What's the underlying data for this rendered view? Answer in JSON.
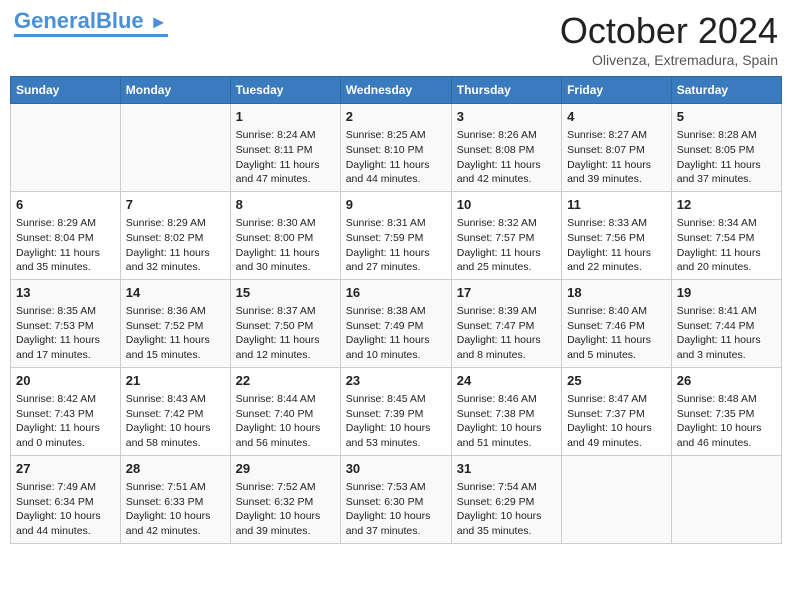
{
  "header": {
    "logo_line1": "General",
    "logo_line2": "Blue",
    "month": "October 2024",
    "location": "Olivenza, Extremadura, Spain"
  },
  "days_of_week": [
    "Sunday",
    "Monday",
    "Tuesday",
    "Wednesday",
    "Thursday",
    "Friday",
    "Saturday"
  ],
  "weeks": [
    [
      {
        "day": "",
        "content": ""
      },
      {
        "day": "",
        "content": ""
      },
      {
        "day": "1",
        "content": "Sunrise: 8:24 AM\nSunset: 8:11 PM\nDaylight: 11 hours and 47 minutes."
      },
      {
        "day": "2",
        "content": "Sunrise: 8:25 AM\nSunset: 8:10 PM\nDaylight: 11 hours and 44 minutes."
      },
      {
        "day": "3",
        "content": "Sunrise: 8:26 AM\nSunset: 8:08 PM\nDaylight: 11 hours and 42 minutes."
      },
      {
        "day": "4",
        "content": "Sunrise: 8:27 AM\nSunset: 8:07 PM\nDaylight: 11 hours and 39 minutes."
      },
      {
        "day": "5",
        "content": "Sunrise: 8:28 AM\nSunset: 8:05 PM\nDaylight: 11 hours and 37 minutes."
      }
    ],
    [
      {
        "day": "6",
        "content": "Sunrise: 8:29 AM\nSunset: 8:04 PM\nDaylight: 11 hours and 35 minutes."
      },
      {
        "day": "7",
        "content": "Sunrise: 8:29 AM\nSunset: 8:02 PM\nDaylight: 11 hours and 32 minutes."
      },
      {
        "day": "8",
        "content": "Sunrise: 8:30 AM\nSunset: 8:00 PM\nDaylight: 11 hours and 30 minutes."
      },
      {
        "day": "9",
        "content": "Sunrise: 8:31 AM\nSunset: 7:59 PM\nDaylight: 11 hours and 27 minutes."
      },
      {
        "day": "10",
        "content": "Sunrise: 8:32 AM\nSunset: 7:57 PM\nDaylight: 11 hours and 25 minutes."
      },
      {
        "day": "11",
        "content": "Sunrise: 8:33 AM\nSunset: 7:56 PM\nDaylight: 11 hours and 22 minutes."
      },
      {
        "day": "12",
        "content": "Sunrise: 8:34 AM\nSunset: 7:54 PM\nDaylight: 11 hours and 20 minutes."
      }
    ],
    [
      {
        "day": "13",
        "content": "Sunrise: 8:35 AM\nSunset: 7:53 PM\nDaylight: 11 hours and 17 minutes."
      },
      {
        "day": "14",
        "content": "Sunrise: 8:36 AM\nSunset: 7:52 PM\nDaylight: 11 hours and 15 minutes."
      },
      {
        "day": "15",
        "content": "Sunrise: 8:37 AM\nSunset: 7:50 PM\nDaylight: 11 hours and 12 minutes."
      },
      {
        "day": "16",
        "content": "Sunrise: 8:38 AM\nSunset: 7:49 PM\nDaylight: 11 hours and 10 minutes."
      },
      {
        "day": "17",
        "content": "Sunrise: 8:39 AM\nSunset: 7:47 PM\nDaylight: 11 hours and 8 minutes."
      },
      {
        "day": "18",
        "content": "Sunrise: 8:40 AM\nSunset: 7:46 PM\nDaylight: 11 hours and 5 minutes."
      },
      {
        "day": "19",
        "content": "Sunrise: 8:41 AM\nSunset: 7:44 PM\nDaylight: 11 hours and 3 minutes."
      }
    ],
    [
      {
        "day": "20",
        "content": "Sunrise: 8:42 AM\nSunset: 7:43 PM\nDaylight: 11 hours and 0 minutes."
      },
      {
        "day": "21",
        "content": "Sunrise: 8:43 AM\nSunset: 7:42 PM\nDaylight: 10 hours and 58 minutes."
      },
      {
        "day": "22",
        "content": "Sunrise: 8:44 AM\nSunset: 7:40 PM\nDaylight: 10 hours and 56 minutes."
      },
      {
        "day": "23",
        "content": "Sunrise: 8:45 AM\nSunset: 7:39 PM\nDaylight: 10 hours and 53 minutes."
      },
      {
        "day": "24",
        "content": "Sunrise: 8:46 AM\nSunset: 7:38 PM\nDaylight: 10 hours and 51 minutes."
      },
      {
        "day": "25",
        "content": "Sunrise: 8:47 AM\nSunset: 7:37 PM\nDaylight: 10 hours and 49 minutes."
      },
      {
        "day": "26",
        "content": "Sunrise: 8:48 AM\nSunset: 7:35 PM\nDaylight: 10 hours and 46 minutes."
      }
    ],
    [
      {
        "day": "27",
        "content": "Sunrise: 7:49 AM\nSunset: 6:34 PM\nDaylight: 10 hours and 44 minutes."
      },
      {
        "day": "28",
        "content": "Sunrise: 7:51 AM\nSunset: 6:33 PM\nDaylight: 10 hours and 42 minutes."
      },
      {
        "day": "29",
        "content": "Sunrise: 7:52 AM\nSunset: 6:32 PM\nDaylight: 10 hours and 39 minutes."
      },
      {
        "day": "30",
        "content": "Sunrise: 7:53 AM\nSunset: 6:30 PM\nDaylight: 10 hours and 37 minutes."
      },
      {
        "day": "31",
        "content": "Sunrise: 7:54 AM\nSunset: 6:29 PM\nDaylight: 10 hours and 35 minutes."
      },
      {
        "day": "",
        "content": ""
      },
      {
        "day": "",
        "content": ""
      }
    ]
  ]
}
